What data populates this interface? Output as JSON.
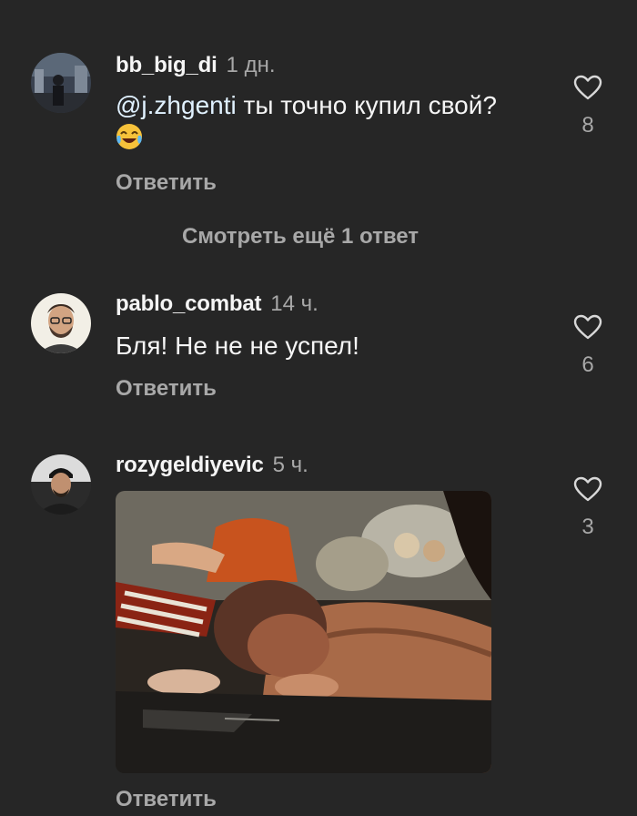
{
  "comments": [
    {
      "username": "bb_big_di",
      "time": "1 дн.",
      "mention": "@j.zhgenti",
      "text": "  ты точно купил свой?",
      "emoji": "laughing-tears-emoji",
      "reply_label": "Ответить",
      "likes": "8",
      "like_icon": "heart-outline-icon"
    },
    {
      "username": "pablo_combat",
      "time": "14 ч.",
      "text": "Бля! Не не не успел!",
      "reply_label": "Ответить",
      "likes": "6",
      "like_icon": "heart-outline-icon"
    },
    {
      "username": "rozygeldiyevic",
      "time": "5 ч.",
      "media": "video-still-image",
      "reply_label": "Ответить",
      "likes": "3",
      "like_icon": "heart-outline-icon"
    }
  ],
  "more_replies": "Смотреть ещё 1 ответ",
  "colors": {
    "background": "#262626",
    "primary_text": "#f5f5f5",
    "secondary_text": "#a8a8a8"
  }
}
